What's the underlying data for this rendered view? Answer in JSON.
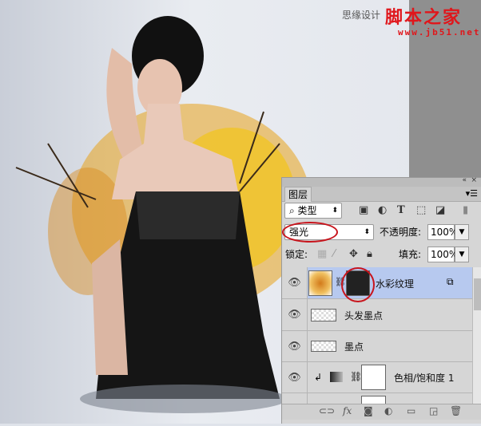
{
  "watermark": {
    "site_cn": "思缘设计",
    "brand": "脚本之家",
    "url": "www.jb51.net"
  },
  "panel": {
    "collapse_icon": "«",
    "close_icon": "×",
    "tab": "图层",
    "menu_icon": "menu-icon",
    "filter": {
      "label": "类型"
    },
    "blend_mode": "强光",
    "opacity_label": "不透明度:",
    "opacity": "100%",
    "lock_label": "锁定:",
    "fill_label": "填充:",
    "fill": "100%",
    "layers": [
      {
        "name": "水彩纹理",
        "selected": true
      },
      {
        "name": "头发墨点"
      },
      {
        "name": "墨点"
      },
      {
        "name": "色相/饱和度 1"
      }
    ],
    "colors": {
      "selected": "#b7c9ef",
      "annotation": "#c8141c"
    }
  }
}
